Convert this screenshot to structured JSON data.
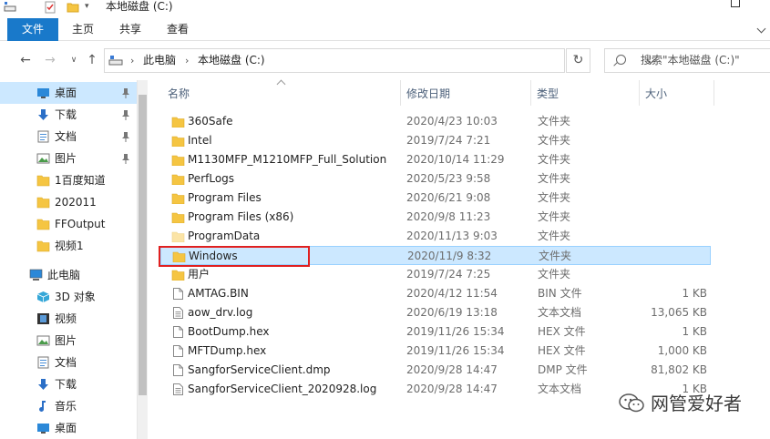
{
  "window": {
    "title": "本地磁盘 (C:)"
  },
  "ribbon": {
    "tabs": [
      "文件",
      "主页",
      "共享",
      "查看"
    ]
  },
  "address": {
    "crumbs": [
      "此电脑",
      "本地磁盘 (C:)"
    ],
    "search_placeholder": "搜索\"本地磁盘 (C:)\""
  },
  "sidebar": {
    "items": [
      {
        "label": "桌面",
        "icon": "desktop-icon",
        "pinned": true,
        "selected": true
      },
      {
        "label": "下载",
        "icon": "download-icon",
        "pinned": true
      },
      {
        "label": "文档",
        "icon": "document-icon",
        "pinned": true
      },
      {
        "label": "图片",
        "icon": "picture-icon",
        "pinned": true
      },
      {
        "label": "1百度知道",
        "icon": "folder-icon"
      },
      {
        "label": "202011",
        "icon": "folder-icon"
      },
      {
        "label": "FFOutput",
        "icon": "folder-icon"
      },
      {
        "label": "视频1",
        "icon": "folder-icon"
      },
      {
        "label": "此电脑",
        "icon": "computer-icon"
      },
      {
        "label": "3D 对象",
        "icon": "3d-objects-icon"
      },
      {
        "label": "视频",
        "icon": "video-icon"
      },
      {
        "label": "图片",
        "icon": "picture-icon"
      },
      {
        "label": "文档",
        "icon": "document-icon"
      },
      {
        "label": "下载",
        "icon": "download-icon"
      },
      {
        "label": "音乐",
        "icon": "music-icon"
      },
      {
        "label": "桌面",
        "icon": "desktop-icon"
      }
    ]
  },
  "columns": {
    "name": "名称",
    "date": "修改日期",
    "type": "类型",
    "size": "大小"
  },
  "files": [
    {
      "name": "360Safe",
      "date": "2020/4/23 10:03",
      "type": "文件夹",
      "size": "",
      "icon": "folder-icon"
    },
    {
      "name": "Intel",
      "date": "2019/7/24 7:21",
      "type": "文件夹",
      "size": "",
      "icon": "folder-icon"
    },
    {
      "name": "M1130MFP_M1210MFP_Full_Solution",
      "date": "2020/10/14 11:29",
      "type": "文件夹",
      "size": "",
      "icon": "folder-icon"
    },
    {
      "name": "PerfLogs",
      "date": "2020/5/23 9:58",
      "type": "文件夹",
      "size": "",
      "icon": "folder-icon"
    },
    {
      "name": "Program Files",
      "date": "2020/6/21 9:08",
      "type": "文件夹",
      "size": "",
      "icon": "folder-icon"
    },
    {
      "name": "Program Files (x86)",
      "date": "2020/9/8 11:23",
      "type": "文件夹",
      "size": "",
      "icon": "folder-icon"
    },
    {
      "name": "ProgramData",
      "date": "2020/11/13 9:03",
      "type": "文件夹",
      "size": "",
      "icon": "folder-hidden-icon"
    },
    {
      "name": "Windows",
      "date": "2020/11/9 8:32",
      "type": "文件夹",
      "size": "",
      "icon": "folder-icon",
      "selected": true
    },
    {
      "name": "用户",
      "date": "2019/7/24 7:25",
      "type": "文件夹",
      "size": "",
      "icon": "folder-icon"
    },
    {
      "name": "AMTAG.BIN",
      "date": "2020/4/12 11:54",
      "type": "BIN 文件",
      "size": "1 KB",
      "icon": "file-icon"
    },
    {
      "name": "aow_drv.log",
      "date": "2020/6/19 13:18",
      "type": "文本文档",
      "size": "13,065 KB",
      "icon": "text-file-icon"
    },
    {
      "name": "BootDump.hex",
      "date": "2019/11/26 15:34",
      "type": "HEX 文件",
      "size": "1 KB",
      "icon": "file-icon"
    },
    {
      "name": "MFTDump.hex",
      "date": "2019/11/26 15:34",
      "type": "HEX 文件",
      "size": "1,000 KB",
      "icon": "file-icon"
    },
    {
      "name": "SangforServiceClient.dmp",
      "date": "2020/9/28 14:47",
      "type": "DMP 文件",
      "size": "81,802 KB",
      "icon": "file-icon"
    },
    {
      "name": "SangforServiceClient_2020928.log",
      "date": "2020/9/28 14:47",
      "type": "文本文档",
      "size": "1 KB",
      "icon": "text-file-icon"
    }
  ],
  "watermark": {
    "text": "网管爱好者"
  },
  "colors": {
    "accent": "#1979ca",
    "selection": "#cce8ff",
    "folder": "#f5c542",
    "highlight": "#e02020"
  }
}
